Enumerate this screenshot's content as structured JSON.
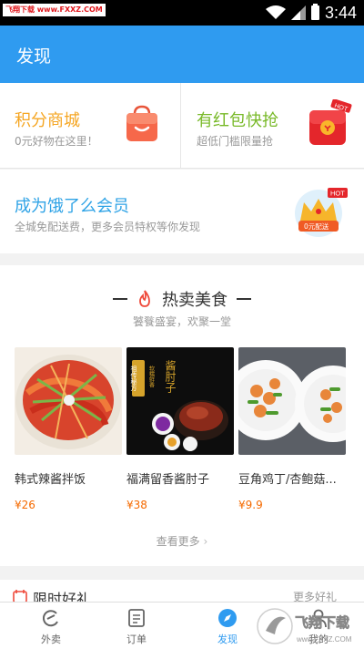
{
  "status_bar": {
    "watermark": "飞翔下载 www.FXXZ.COM",
    "time": "3:44"
  },
  "header": {
    "title": "发现"
  },
  "promos": [
    {
      "title": "积分商城",
      "subtitle": "0元好物在这里！",
      "color": "#f5a623"
    },
    {
      "title": "有红包快抢",
      "subtitle": "超低门槛限量抢",
      "color": "#78b928",
      "badge": "HOT"
    }
  ],
  "vip": {
    "title": "成为饿了么会员",
    "subtitle": "全城免配送费，更多会员特权等你发现",
    "badge": "HOT",
    "badge_label": "0元配送"
  },
  "hot_food": {
    "title": "热卖美食",
    "subtitle": "饕餮盛宴，欢聚一堂",
    "items": [
      {
        "name": "韩式辣酱拌饭",
        "price": "¥26"
      },
      {
        "name": "福满留香酱肘子",
        "price": "¥38",
        "image_text": "酱肘子",
        "image_tag": "祖传秘方",
        "image_tag2": "软糯鲜香"
      },
      {
        "name": "豆角鸡丁/杏鲍菇...",
        "price": "¥9.9"
      }
    ],
    "more": "查看更多"
  },
  "limited": {
    "title": "限时好礼",
    "more": "更多好礼"
  },
  "bottom_nav": [
    {
      "label": "外卖",
      "icon": "ele-logo-icon",
      "active": false
    },
    {
      "label": "订单",
      "icon": "order-list-icon",
      "active": false
    },
    {
      "label": "发现",
      "icon": "compass-icon",
      "active": true
    },
    {
      "label": "我的",
      "icon": "profile-icon",
      "active": false
    }
  ],
  "watermark_corner": {
    "text": "飞翔下载",
    "url": "www.FXXZ.COM"
  },
  "colors": {
    "primary": "#2f9bf0",
    "price": "#f56a00",
    "promo_orange": "#f5a623",
    "promo_green": "#78b928",
    "vip_blue": "#2fa3e6"
  }
}
